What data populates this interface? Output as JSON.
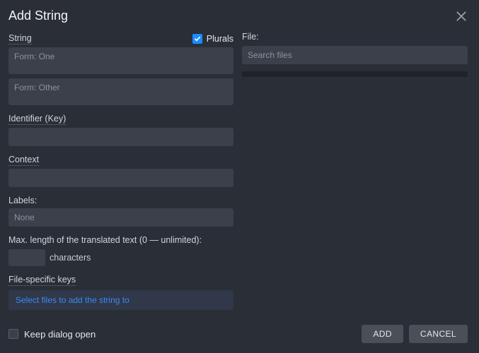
{
  "dialog": {
    "title": "Add String"
  },
  "stringSection": {
    "label": "String",
    "pluralsLabel": "Plurals",
    "formOnePlaceholder": "Form: One",
    "formOtherPlaceholder": "Form: Other"
  },
  "identifier": {
    "label": "Identifier (Key)"
  },
  "context": {
    "label": "Context"
  },
  "labels": {
    "label": "Labels:",
    "placeholder": "None"
  },
  "maxlen": {
    "label": "Max. length of the translated text (0 — unlimited):",
    "unit": "characters"
  },
  "fileSpecific": {
    "label": "File-specific keys",
    "selectPrompt": "Select files to add the string to"
  },
  "fileSection": {
    "label": "File:",
    "searchPlaceholder": "Search files"
  },
  "footer": {
    "keepOpen": "Keep dialog open",
    "add": "ADD",
    "cancel": "CANCEL"
  }
}
